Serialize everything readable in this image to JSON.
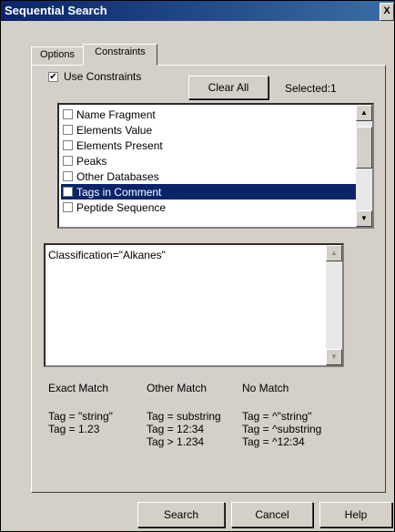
{
  "window": {
    "title": "Sequential Search",
    "close_glyph": "X"
  },
  "tabs": [
    {
      "label": "Options"
    },
    {
      "label": "Constraints"
    }
  ],
  "use_constraints": {
    "label": "Use Constraints",
    "checked": true,
    "check_glyph": "✔"
  },
  "clear_all_label": "Clear All",
  "selected_text": "Selected:1",
  "list_items": [
    {
      "label": "Name Fragment",
      "checked": false
    },
    {
      "label": "Elements Value",
      "checked": false
    },
    {
      "label": "Elements Present",
      "checked": false
    },
    {
      "label": "Peaks",
      "checked": false
    },
    {
      "label": "Other Databases",
      "checked": false
    },
    {
      "label": "Tags in Comment",
      "checked": true
    },
    {
      "label": "Peptide Sequence",
      "checked": false
    }
  ],
  "expression_value": "Classification=\"Alkanes\"",
  "hints": {
    "exact": {
      "title": "Exact Match",
      "lines": [
        "Tag = \"string\"",
        "Tag = 1.23"
      ]
    },
    "other": {
      "title": "Other Match",
      "lines": [
        "Tag = substring",
        "Tag = 12:34",
        "Tag > 1.234"
      ]
    },
    "none": {
      "title": "No Match",
      "lines": [
        "Tag = ^\"string\"",
        "Tag = ^substring",
        "Tag = ^12:34"
      ]
    }
  },
  "footer": {
    "search": "Search",
    "cancel": "Cancel",
    "help": "Help"
  },
  "icons": {
    "scroll_up": "▲",
    "scroll_down": "▼"
  },
  "colors": {
    "selection": "#0a246a",
    "titlebar": "#0a246a",
    "face": "#d4d0c8"
  }
}
